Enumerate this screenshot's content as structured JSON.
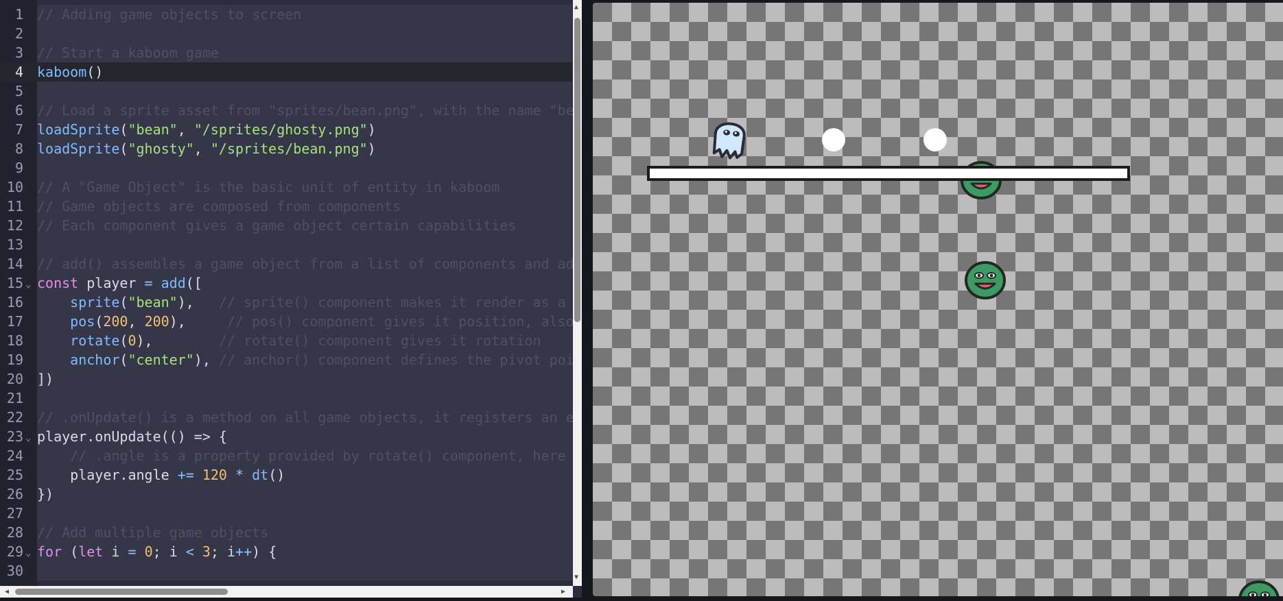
{
  "editor": {
    "lines": [
      {
        "n": "1",
        "tokens": [
          [
            "cm",
            "// Adding game objects to screen"
          ]
        ]
      },
      {
        "n": "2",
        "tokens": []
      },
      {
        "n": "3",
        "tokens": [
          [
            "cm",
            "// Start a kaboom game"
          ]
        ]
      },
      {
        "n": "4",
        "tokens": [
          [
            "fn",
            "kaboom"
          ],
          [
            "txt",
            "()"
          ]
        ],
        "active": true
      },
      {
        "n": "5",
        "tokens": []
      },
      {
        "n": "6",
        "tokens": [
          [
            "cm",
            "// Load a sprite asset from \"sprites/bean.png\", with the name \"be"
          ]
        ]
      },
      {
        "n": "7",
        "tokens": [
          [
            "fn",
            "loadSprite"
          ],
          [
            "txt",
            "("
          ],
          [
            "str",
            "\"bean\""
          ],
          [
            "txt",
            ", "
          ],
          [
            "str",
            "\"/sprites/ghosty.png\""
          ],
          [
            "txt",
            ")"
          ]
        ]
      },
      {
        "n": "8",
        "tokens": [
          [
            "fn",
            "loadSprite"
          ],
          [
            "txt",
            "("
          ],
          [
            "str",
            "\"ghosty\""
          ],
          [
            "txt",
            ", "
          ],
          [
            "str",
            "\"/sprites/bean.png\""
          ],
          [
            "txt",
            ")"
          ]
        ]
      },
      {
        "n": "9",
        "tokens": []
      },
      {
        "n": "10",
        "tokens": [
          [
            "cm",
            "// A \"Game Object\" is the basic unit of entity in kaboom"
          ]
        ]
      },
      {
        "n": "11",
        "tokens": [
          [
            "cm",
            "// Game objects are composed from components"
          ]
        ]
      },
      {
        "n": "12",
        "tokens": [
          [
            "cm",
            "// Each component gives a game object certain capabilities"
          ]
        ]
      },
      {
        "n": "13",
        "tokens": []
      },
      {
        "n": "14",
        "tokens": [
          [
            "cm",
            "// add() assembles a game object from a list of components and ad"
          ]
        ]
      },
      {
        "n": "15",
        "fold": true,
        "tokens": [
          [
            "kw",
            "const"
          ],
          [
            "txt",
            " player "
          ],
          [
            "op",
            "="
          ],
          [
            "txt",
            " "
          ],
          [
            "fn",
            "add"
          ],
          [
            "txt",
            "(["
          ]
        ]
      },
      {
        "n": "16",
        "tokens": [
          [
            "txt",
            "    "
          ],
          [
            "fn",
            "sprite"
          ],
          [
            "txt",
            "("
          ],
          [
            "str",
            "\"bean\""
          ],
          [
            "txt",
            "),   "
          ],
          [
            "cm",
            "// sprite() component makes it render as a"
          ]
        ]
      },
      {
        "n": "17",
        "tokens": [
          [
            "txt",
            "    "
          ],
          [
            "fn",
            "pos"
          ],
          [
            "txt",
            "("
          ],
          [
            "num",
            "200"
          ],
          [
            "txt",
            ", "
          ],
          [
            "num",
            "200"
          ],
          [
            "txt",
            "),     "
          ],
          [
            "cm",
            "// pos() component gives it position, also"
          ]
        ]
      },
      {
        "n": "18",
        "tokens": [
          [
            "txt",
            "    "
          ],
          [
            "fn",
            "rotate"
          ],
          [
            "txt",
            "("
          ],
          [
            "num",
            "0"
          ],
          [
            "txt",
            "),        "
          ],
          [
            "cm",
            "// rotate() component gives it rotation"
          ]
        ]
      },
      {
        "n": "19",
        "tokens": [
          [
            "txt",
            "    "
          ],
          [
            "fn",
            "anchor"
          ],
          [
            "txt",
            "("
          ],
          [
            "str",
            "\"center\""
          ],
          [
            "txt",
            "), "
          ],
          [
            "cm",
            "// anchor() component defines the pivot poi"
          ]
        ]
      },
      {
        "n": "20",
        "tokens": [
          [
            "txt",
            "])"
          ]
        ]
      },
      {
        "n": "21",
        "tokens": []
      },
      {
        "n": "22",
        "tokens": [
          [
            "cm",
            "// .onUpdate() is a method on all game objects, it registers an e"
          ]
        ]
      },
      {
        "n": "23",
        "fold": true,
        "tokens": [
          [
            "txt",
            "player.onUpdate(() => {"
          ]
        ]
      },
      {
        "n": "24",
        "tokens": [
          [
            "txt",
            "    "
          ],
          [
            "cm",
            "// .angle is a property provided by rotate() component, here"
          ]
        ]
      },
      {
        "n": "25",
        "tokens": [
          [
            "txt",
            "    player.angle "
          ],
          [
            "op",
            "+="
          ],
          [
            "txt",
            " "
          ],
          [
            "num",
            "120"
          ],
          [
            "txt",
            " "
          ],
          [
            "op",
            "*"
          ],
          [
            "txt",
            " "
          ],
          [
            "fn",
            "dt"
          ],
          [
            "txt",
            "()"
          ]
        ]
      },
      {
        "n": "26",
        "tokens": [
          [
            "txt",
            "})"
          ]
        ]
      },
      {
        "n": "27",
        "tokens": []
      },
      {
        "n": "28",
        "tokens": [
          [
            "cm",
            "// Add multiple game objects"
          ]
        ]
      },
      {
        "n": "29",
        "fold": true,
        "tokens": [
          [
            "kw",
            "for"
          ],
          [
            "txt",
            " ("
          ],
          [
            "kw",
            "let"
          ],
          [
            "txt",
            " i "
          ],
          [
            "op",
            "="
          ],
          [
            "txt",
            " "
          ],
          [
            "num",
            "0"
          ],
          [
            "txt",
            "; i "
          ],
          [
            "op",
            "<"
          ],
          [
            "txt",
            " "
          ],
          [
            "num",
            "3"
          ],
          [
            "txt",
            "; i"
          ],
          [
            "op",
            "++"
          ],
          [
            "txt",
            ") {"
          ]
        ]
      },
      {
        "n": "30",
        "tokens": []
      }
    ],
    "fold_glyph": "⌄"
  },
  "colors": {
    "comment": "#4d5066",
    "function": "#7fbcff",
    "string": "#a5e27c",
    "number": "#f2c071",
    "keyword": "#e78ce6",
    "checker_light": "#bcbcbc",
    "checker_dark": "#767676"
  },
  "scrollbars": {
    "up_arrow": "▲",
    "down_arrow": "▼",
    "left_arrow": "◀",
    "right_arrow": "▶"
  },
  "game": {
    "sprites": [
      "ghosty-sprite",
      "white-ball",
      "white-ball",
      "bean-sprite",
      "bean-sprite",
      "bean-sprite",
      "white-platform"
    ]
  }
}
